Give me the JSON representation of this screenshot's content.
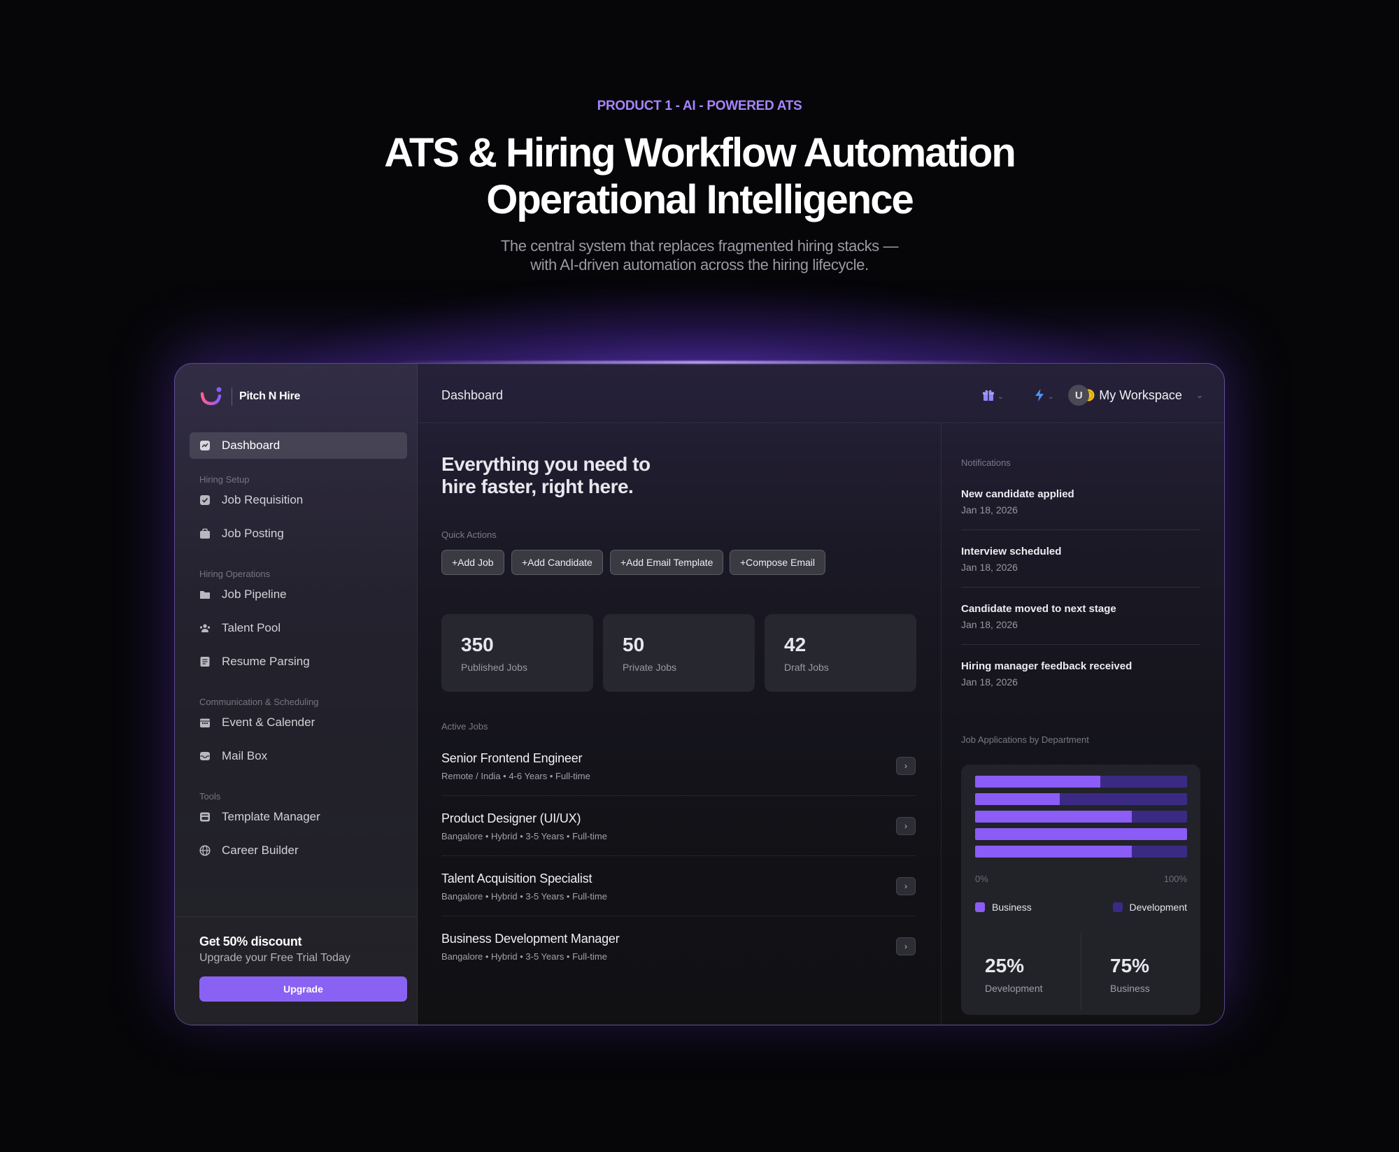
{
  "hero": {
    "eyebrow": "PRODUCT 1 - AI - POWERED ATS",
    "headline_line1": "ATS & Hiring Workflow Automation",
    "headline_line2": "Operational Intelligence",
    "sub_line1": "The central system that replaces fragmented hiring stacks —",
    "sub_line2": "with AI-driven automation across the hiring lifecycle."
  },
  "brand": {
    "name": "Pitch N Hire"
  },
  "sidebar": {
    "dashboard": "Dashboard",
    "sections": {
      "hiring_setup": "Hiring Setup",
      "hiring_operations": "Hiring Operations",
      "communication": "Communication & Scheduling",
      "tools": "Tools"
    },
    "items": {
      "job_requisition": "Job Requisition",
      "job_posting": "Job Posting",
      "job_pipeline": "Job Pipeline",
      "talent_pool": "Talent Pool",
      "resume_parsing": "Resume Parsing",
      "event_calender": "Event & Calender",
      "mail_box": "Mail Box",
      "template_manager": "Template Manager",
      "career_builder": "Career Builder"
    },
    "promo": {
      "title": "Get 50% discount",
      "subtitle": "Upgrade your Free Trial Today",
      "button": "Upgrade"
    }
  },
  "header": {
    "title": "Dashboard",
    "workspace_initial": "U",
    "workspace_name": "My Workspace"
  },
  "main": {
    "hello_line1": "Everything you need to",
    "hello_line2": "hire faster, right here.",
    "quick_actions_label": "Quick Actions",
    "quick_actions": [
      "+Add Job",
      "+Add Candidate",
      "+Add Email Template",
      "+Compose Email"
    ],
    "stats": [
      {
        "value": "350",
        "label": "Published Jobs"
      },
      {
        "value": "50",
        "label": "Private Jobs"
      },
      {
        "value": "42",
        "label": "Draft Jobs"
      }
    ],
    "active_jobs_label": "Active Jobs",
    "jobs": [
      {
        "title": "Senior Frontend Engineer",
        "meta": "Remote / India • 4-6 Years • Full-time"
      },
      {
        "title": "Product Designer (UI/UX)",
        "meta": "Bangalore • Hybrid • 3-5 Years • Full-time"
      },
      {
        "title": "Talent Acquisition Specialist",
        "meta": "Bangalore • Hybrid • 3-5 Years • Full-time"
      },
      {
        "title": "Business Development Manager",
        "meta": "Bangalore • Hybrid • 3-5 Years • Full-time"
      }
    ]
  },
  "notifications": {
    "label": "Notifications",
    "items": [
      {
        "title": "New candidate applied",
        "date": "Jan 18, 2026"
      },
      {
        "title": "Interview scheduled",
        "date": "Jan 18, 2026"
      },
      {
        "title": "Candidate moved to next stage",
        "date": "Jan 18, 2026"
      },
      {
        "title": "Hiring manager feedback received",
        "date": "Jan 18, 2026"
      }
    ]
  },
  "chart_title": "Job Applications by Department",
  "chart_data": {
    "type": "bar",
    "orientation": "horizontal-stacked",
    "series": [
      {
        "name": "Business",
        "color": "#8b5cf6",
        "values": [
          59,
          40,
          74,
          100,
          74
        ]
      },
      {
        "name": "Development",
        "color": "#3b2a84",
        "values": [
          41,
          60,
          26,
          0,
          26
        ]
      }
    ],
    "xlim": [
      0,
      100
    ],
    "xtick_labels": [
      "0%",
      "100%"
    ],
    "legend": "bottom",
    "summary": [
      {
        "value": "25%",
        "label": "Development"
      },
      {
        "value": "75%",
        "label": "Business"
      }
    ]
  },
  "colors": {
    "accent": "#8a62f3",
    "eyebrow": "#a585ff",
    "coin": "#f2c01e",
    "bolt": "#4f8ff7",
    "gift": "#8d86ff"
  }
}
